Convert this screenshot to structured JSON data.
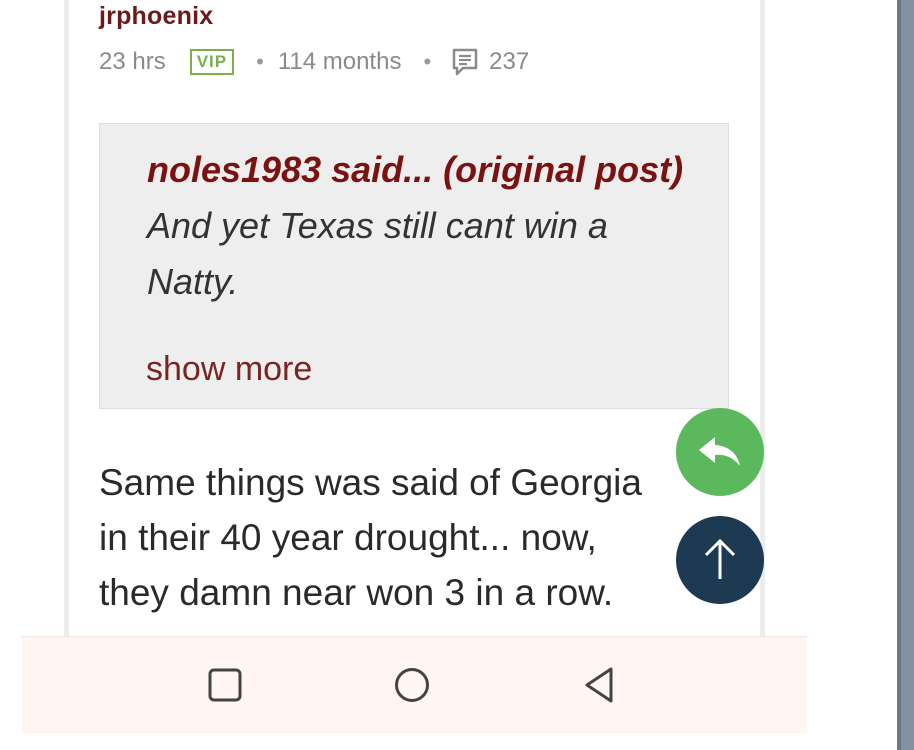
{
  "post": {
    "username": "jrphoenix",
    "time_ago": "23 hrs",
    "badge": "VIP",
    "tenure": "114 months",
    "post_count": "237"
  },
  "quote": {
    "author": "noles1983 said... (original post)",
    "text": " And yet Texas still cant win a Natty.",
    "show_more": "show more"
  },
  "reply": {
    "lines": [
      "Same things was said of Georgia",
      "in their 40 year drought... now,",
      "they damn near won 3 in a row."
    ]
  },
  "icons": {
    "comment": "comment-icon",
    "reply": "reply-arrow-icon",
    "scroll_top": "arrow-up-icon",
    "nav_recent": "square-icon",
    "nav_home": "circle-icon",
    "nav_back": "triangle-back-icon"
  },
  "colors": {
    "username": "#6b1a1a",
    "vip": "#7cae4b",
    "quote_author": "#7b1212",
    "reply_fab": "#5cb85c",
    "top_fab": "#1e3a52",
    "navbar": "#fff5f2"
  }
}
